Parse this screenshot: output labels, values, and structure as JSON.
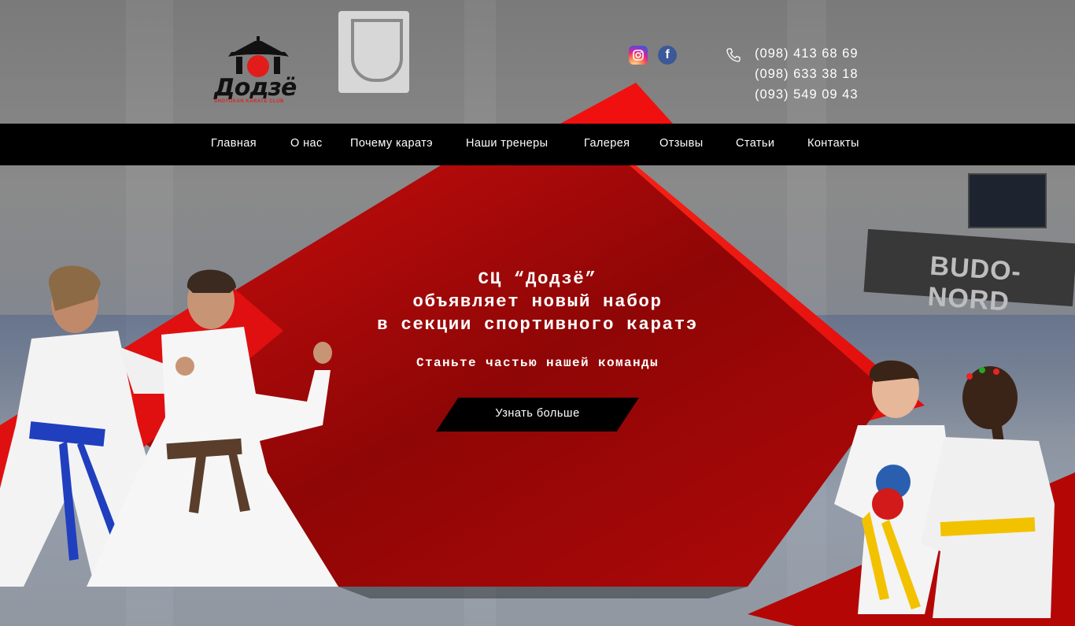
{
  "brand": {
    "logo_word": "Додзё",
    "logo_subtitle": "SHOTOKAN KARATE CLUB"
  },
  "socials": [
    {
      "name": "instagram-icon",
      "color": "#d6249f"
    },
    {
      "name": "facebook-icon",
      "color": "#3b5998",
      "glyph": "f"
    }
  ],
  "contacts": {
    "phones": [
      "(098) 413 68 69",
      "(098) 633 38 18",
      "(093) 549 09 43"
    ]
  },
  "nav": {
    "items": [
      {
        "label": "Главная"
      },
      {
        "label": "О нас"
      },
      {
        "label": "Почему каратэ"
      },
      {
        "label": "Наши тренеры"
      },
      {
        "label": "Галерея"
      },
      {
        "label": "Отзывы"
      },
      {
        "label": "Статьи"
      },
      {
        "label": "Контакты"
      }
    ]
  },
  "hero": {
    "title_line1": "СЦ “Додзё”",
    "title_line2": "объявляет новый набор",
    "title_line3": "в секции спортивного каратэ",
    "subtitle": "Станьте частью нашей команды",
    "cta_label": "Узнать больше"
  },
  "background": {
    "banner_text": "BUDO-NORD"
  },
  "colors": {
    "accent_red": "#e81010",
    "dark_red": "#8a0a0a",
    "nav_bg": "#000000"
  }
}
